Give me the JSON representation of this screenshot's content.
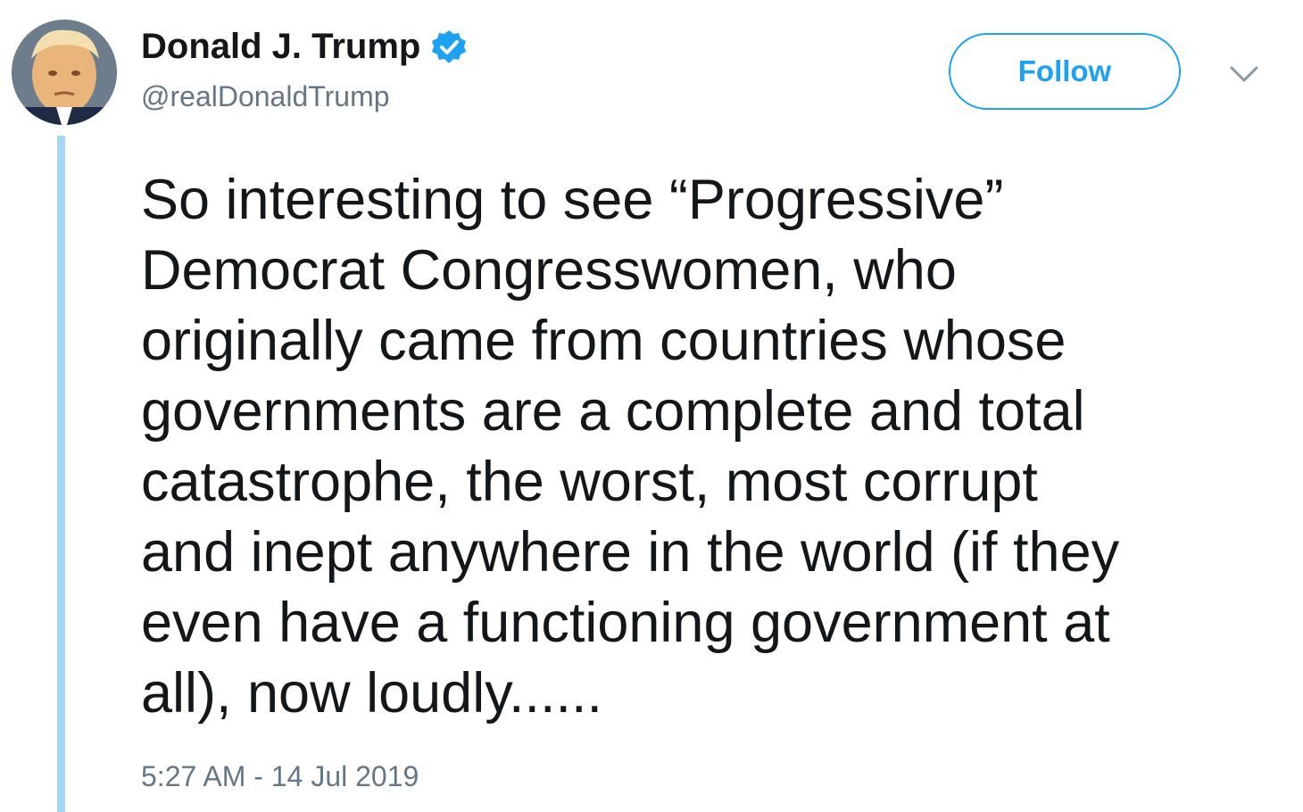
{
  "author": {
    "name": "Donald J. Trump",
    "handle": "@realDonaldTrump",
    "verified": true
  },
  "actions": {
    "follow_label": "Follow",
    "menu_icon": "chevron-down-icon"
  },
  "tweet": {
    "text": "So interesting to see “Progressive”\nDemocrat Congresswomen, who\noriginally came from countries whose\ngovernments are a complete and total\ncatastrophe, the worst, most corrupt\nand inept anywhere in the world (if they\neven have a functioning government at\nall), now loudly......",
    "timestamp": "5:27 AM - 14 Jul 2019"
  },
  "colors": {
    "accent": "#1da1f2",
    "thread_line": "#a6d6f6",
    "secondary_text": "#657786"
  }
}
